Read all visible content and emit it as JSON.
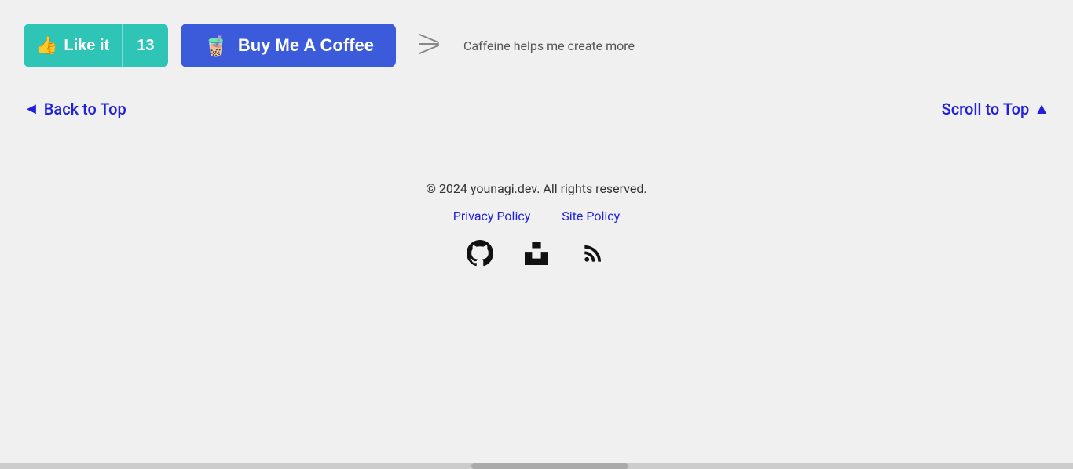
{
  "like_button": {
    "label": "Like it",
    "count": "13",
    "bg_color": "#2ec4b6"
  },
  "coffee_button": {
    "label": "Buy Me A Coffee",
    "bg_color": "#3b5bdb",
    "icon": "☕"
  },
  "caffeine_text": "Caffeine helps me create more",
  "back_to_top": {
    "label": "Back to Top",
    "arrow": "◄"
  },
  "scroll_to_top": {
    "label": "Scroll to Top",
    "arrow": "▲"
  },
  "footer": {
    "copyright": "© 2024 younagi.dev. All rights reserved.",
    "links": [
      {
        "label": "Privacy Policy",
        "url": "#"
      },
      {
        "label": "Site Policy",
        "url": "#"
      }
    ],
    "icons": [
      {
        "name": "github",
        "label": "GitHub"
      },
      {
        "name": "unsplash",
        "label": "Unsplash"
      },
      {
        "name": "rss",
        "label": "RSS"
      }
    ]
  }
}
